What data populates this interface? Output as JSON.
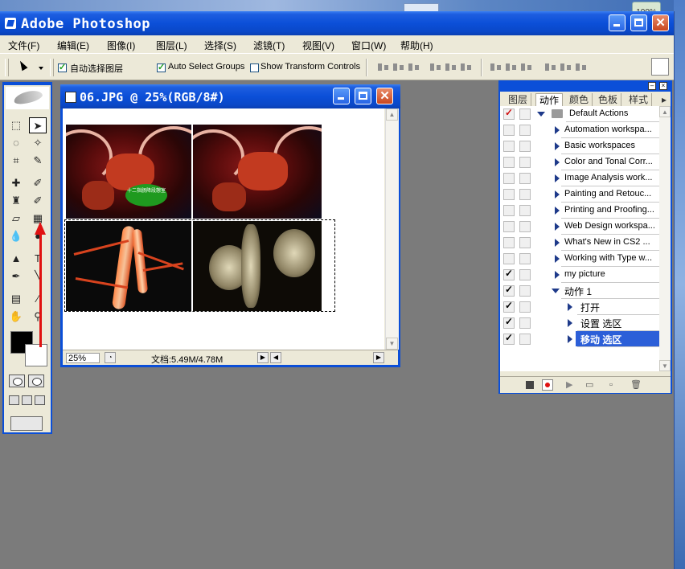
{
  "app": {
    "title": "Adobe Photoshop"
  },
  "system": {
    "zoom_badge": "100%"
  },
  "menu": [
    "文件(F)",
    "编辑(E)",
    "图像(I)",
    "图层(L)",
    "选择(S)",
    "滤镜(T)",
    "视图(V)",
    "窗口(W)",
    "帮助(H)"
  ],
  "options": {
    "auto_select_layer_label": "自动选择图层",
    "auto_select_layer_checked": true,
    "auto_select_groups_label": "Auto Select Groups",
    "auto_select_groups_checked": true,
    "show_transform_label": "Show Transform Controls",
    "show_transform_checked": false
  },
  "document": {
    "title": "06.JPG @ 25%(RGB/8#)",
    "zoom": "25%",
    "info": "文档:5.49M/4.78M",
    "callout": "十二指肠降段憩室"
  },
  "panel": {
    "tabs": [
      "图层",
      "动作",
      "颜色",
      "色板",
      "样式"
    ],
    "active_tab": "动作",
    "actions": [
      {
        "label": "Default Actions",
        "type": "set",
        "expanded": true,
        "checked": true,
        "check_color": "red"
      },
      {
        "label": "Automation workspa...",
        "type": "action",
        "checked": false
      },
      {
        "label": "Basic workspaces",
        "type": "action",
        "checked": false
      },
      {
        "label": "Color and Tonal Corr...",
        "type": "action",
        "checked": false
      },
      {
        "label": "Image Analysis work...",
        "type": "action",
        "checked": false
      },
      {
        "label": "Painting and Retouc...",
        "type": "action",
        "checked": false
      },
      {
        "label": "Printing and Proofing...",
        "type": "action",
        "checked": false
      },
      {
        "label": "Web Design workspa...",
        "type": "action",
        "checked": false
      },
      {
        "label": "What's New in CS2 ...",
        "type": "action",
        "checked": false
      },
      {
        "label": "Working with Type w...",
        "type": "action",
        "checked": false
      },
      {
        "label": "my picture",
        "type": "action",
        "checked": true
      },
      {
        "label": "动作 1",
        "type": "action-open",
        "checked": true
      },
      {
        "label": "打开",
        "type": "step",
        "checked": true
      },
      {
        "label": "设置 选区",
        "type": "step",
        "checked": true
      },
      {
        "label": "移动 选区",
        "type": "step",
        "checked": true,
        "selected": true
      }
    ]
  },
  "colors": {
    "accent": "#0b4fd8",
    "selection": "#2c5fd8",
    "annotation_arrow": "#e01212"
  }
}
